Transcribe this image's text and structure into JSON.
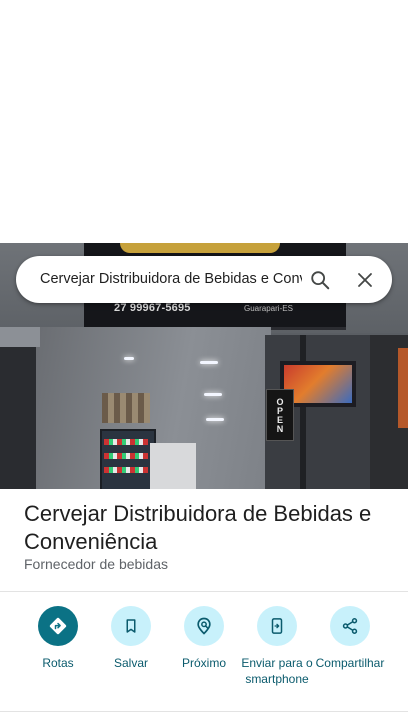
{
  "search": {
    "query": "Cervejar Distribuidora de Bebidas e Conveniência"
  },
  "photo": {
    "sign_phone": "27 99967-5695",
    "sign_city": "Guarapari-ES",
    "door_sign": "OPEN"
  },
  "place": {
    "name": "Cervejar Distribuidora de Bebidas e Conveniência",
    "category": "Fornecedor de bebidas"
  },
  "actions": [
    {
      "label": "Rotas",
      "icon": "directions-icon"
    },
    {
      "label": "Salvar",
      "icon": "bookmark-icon"
    },
    {
      "label": "Próximo",
      "icon": "nearby-icon"
    },
    {
      "label": "Enviar para o smartphone",
      "icon": "send-to-phone-icon"
    },
    {
      "label": "Compartilhar",
      "icon": "share-icon"
    }
  ],
  "colors": {
    "primary": "#0b7285",
    "primary_tonal": "#c8f1fb",
    "action_text": "#0b5b6d"
  }
}
